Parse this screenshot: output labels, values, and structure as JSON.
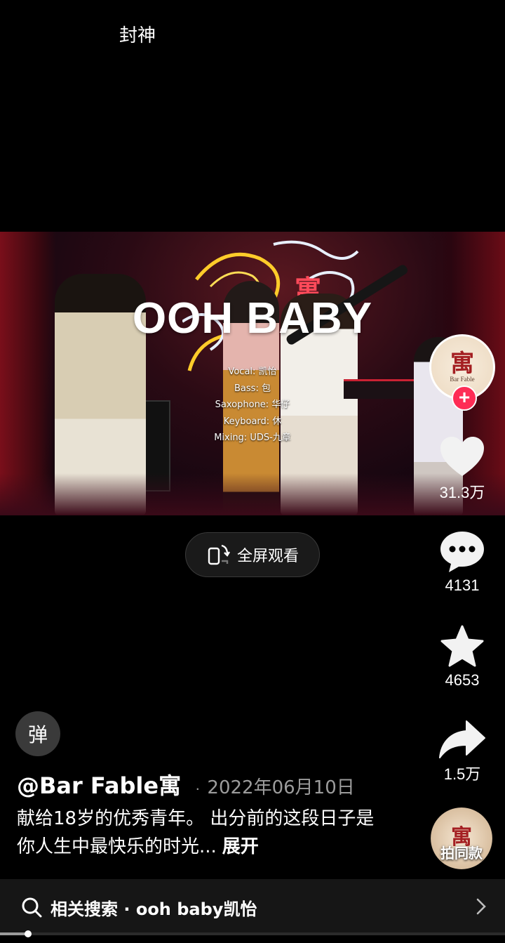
{
  "top_caption": "封神",
  "video": {
    "title": "OOH BABY",
    "credits": [
      "Vocal: 凯怡",
      "Bass: 包",
      "Saxophone: 华仔",
      "Keyboard: 休",
      "Mixing: UDS-九章"
    ],
    "neon_sign_text": "寓"
  },
  "fullscreen_button": {
    "label": "全屏观看",
    "icon": "rotate-screen-icon"
  },
  "creator_avatar": {
    "glyph": "寓",
    "subtext": "Bar Fable",
    "follow_symbol": "+"
  },
  "actions": {
    "like": {
      "count": "31.3万",
      "icon": "heart-icon"
    },
    "comment": {
      "count": "4131",
      "icon": "comment-icon"
    },
    "favorite": {
      "count": "4653",
      "icon": "star-icon"
    },
    "share": {
      "count": "1.5万",
      "icon": "share-icon"
    }
  },
  "danmu_button": {
    "label": "弹"
  },
  "post": {
    "author": "@Bar Fable寓",
    "separator": "·",
    "date": "2022年06月10日",
    "description": "献给18岁的优秀青年。 出分前的这段日子是你人生中最快乐的时光...",
    "expand_label": "展开"
  },
  "music_disc": {
    "glyph": "寓",
    "label": "拍同款"
  },
  "related_search": {
    "label": "相关搜索 · ooh baby凯怡",
    "icon": "search-icon"
  },
  "playback": {
    "progress_fraction": 0.055
  },
  "colors": {
    "accent": "#fe2c55",
    "background": "#000000",
    "secondary_text": "#9c9c9c"
  }
}
